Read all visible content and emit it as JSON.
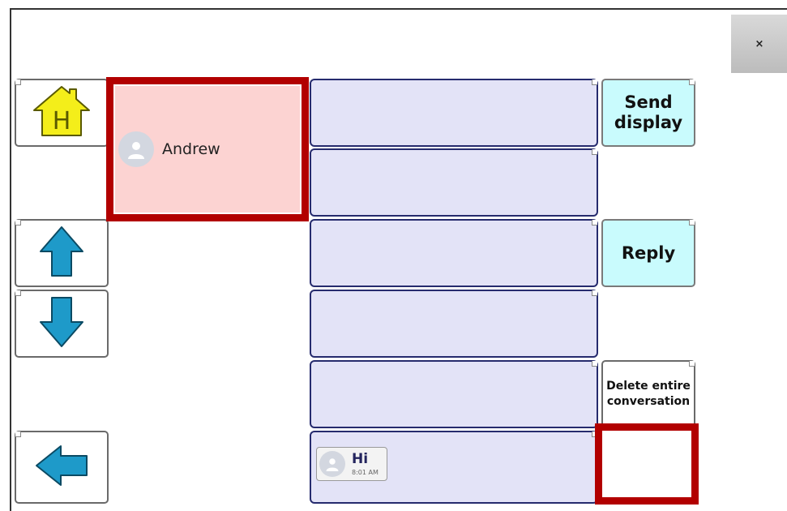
{
  "window": {
    "close_label": "×"
  },
  "contact": {
    "name": "Andrew"
  },
  "actions": {
    "send_display": "Send display",
    "reply": "Reply",
    "delete_conversation": "Delete entire conversation"
  },
  "messages": [
    {
      "text": ""
    },
    {
      "text": ""
    },
    {
      "text": ""
    },
    {
      "text": ""
    },
    {
      "text": ""
    },
    {
      "text": "Hi",
      "time": "8:01 AM"
    }
  ],
  "icons": {
    "home": "home-icon",
    "up": "arrow-up-icon",
    "down": "arrow-down-icon",
    "back": "arrow-left-icon",
    "avatar": "person-icon"
  },
  "colors": {
    "selection_red": "#b20000",
    "contact_bg": "#fcd3d2",
    "message_bg": "#e3e3f7",
    "message_border": "#262b6e",
    "action_cyan": "#c9fbfd",
    "arrow_blue": "#1e9ac9",
    "home_yellow": "#f4ee1a"
  }
}
